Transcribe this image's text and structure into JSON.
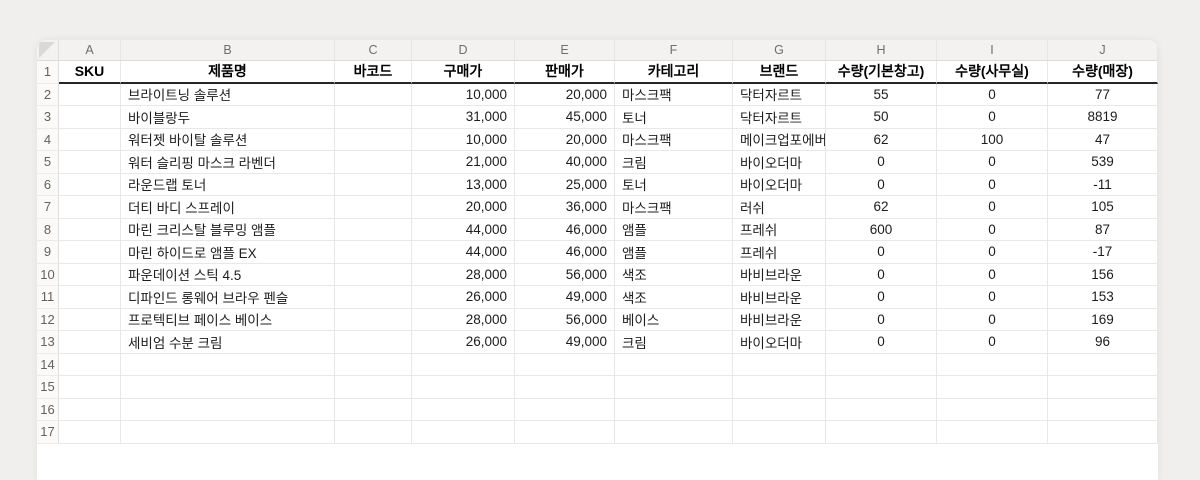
{
  "app": {
    "type": "spreadsheet-grid"
  },
  "colors": {
    "page_background": "#f0efee",
    "sheet_background": "#ffffff",
    "header_strip_background": "#f3f2f1",
    "gridline": "#e9e8e7",
    "header_underline": "#262626",
    "header_letter_text": "#6f6e6d"
  },
  "sheet": {
    "column_letters": [
      "A",
      "B",
      "C",
      "D",
      "E",
      "F",
      "G",
      "H",
      "I",
      "J"
    ],
    "visible_row_count": 17,
    "field_headers": [
      "SKU",
      "제품명",
      "바코드",
      "구매가",
      "판매가",
      "카테고리",
      "브랜드",
      "수량(기본창고)",
      "수량(사무실)",
      "수량(매장)"
    ],
    "rows": [
      [
        "",
        "브라이트닝 솔루션",
        "",
        "10,000",
        "20,000",
        "마스크팩",
        "닥터자르트",
        "55",
        "0",
        "77"
      ],
      [
        "",
        "바이블랑두",
        "",
        "31,000",
        "45,000",
        "토너",
        "닥터자르트",
        "50",
        "0",
        "8819"
      ],
      [
        "",
        "워터젯 바이탈 솔루션",
        "",
        "10,000",
        "20,000",
        "마스크팩",
        "메이크업포에버",
        "62",
        "100",
        "47"
      ],
      [
        "",
        "워터 슬리핑 마스크 라벤더",
        "",
        "21,000",
        "40,000",
        "크림",
        "바이오더마",
        "0",
        "0",
        "539"
      ],
      [
        "",
        "라운드랩 토너",
        "",
        "13,000",
        "25,000",
        "토너",
        "바이오더마",
        "0",
        "0",
        "-11"
      ],
      [
        "",
        "더티 바디 스프레이",
        "",
        "20,000",
        "36,000",
        "마스크팩",
        "러쉬",
        "62",
        "0",
        "105"
      ],
      [
        "",
        "마린 크리스탈 블루밍 앰플",
        "",
        "44,000",
        "46,000",
        "앰플",
        "프레쉬",
        "600",
        "0",
        "87"
      ],
      [
        "",
        "마린 하이드로 앰플 EX",
        "",
        "44,000",
        "46,000",
        "앰플",
        "프레쉬",
        "0",
        "0",
        "-17"
      ],
      [
        "",
        "파운데이션 스틱 4.5",
        "",
        "28,000",
        "56,000",
        "색조",
        "바비브라운",
        "0",
        "0",
        "156"
      ],
      [
        "",
        "디파인드 롱웨어 브라우 펜슬",
        "",
        "26,000",
        "49,000",
        "색조",
        "바비브라운",
        "0",
        "0",
        "153"
      ],
      [
        "",
        "프로텍티브 페이스 베이스",
        "",
        "28,000",
        "56,000",
        "베이스",
        "바비브라운",
        "0",
        "0",
        "169"
      ],
      [
        "",
        "세비엄 수분 크림",
        "",
        "26,000",
        "49,000",
        "크림",
        "바이오더마",
        "0",
        "0",
        "96"
      ]
    ]
  }
}
